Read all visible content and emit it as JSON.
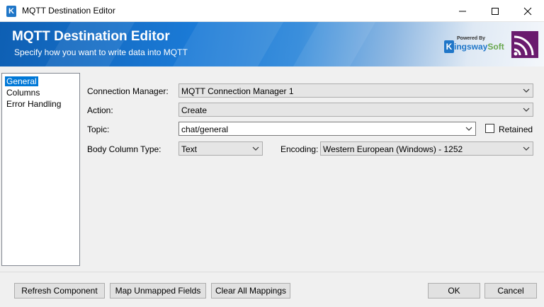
{
  "window": {
    "title": "MQTT Destination Editor",
    "app_icon_letter": "K"
  },
  "banner": {
    "title": "MQTT Destination Editor",
    "subtitle": "Specify how you want to write data into MQTT",
    "logo_powered": "Powered By",
    "logo_letter": "K",
    "logo_name": "ingsway",
    "logo_name_suffix": "Soft"
  },
  "tree": {
    "items": [
      {
        "label": "General",
        "selected": true
      },
      {
        "label": "Columns",
        "selected": false
      },
      {
        "label": "Error Handling",
        "selected": false
      }
    ]
  },
  "form": {
    "connection_manager": {
      "label": "Connection Manager:",
      "value": "MQTT Connection Manager 1"
    },
    "action": {
      "label": "Action:",
      "value": "Create"
    },
    "topic": {
      "label": "Topic:",
      "value": "chat/general"
    },
    "retained": {
      "label": "Retained",
      "checked": false
    },
    "body_column_type": {
      "label": "Body Column Type:",
      "value": "Text"
    },
    "encoding": {
      "label": "Encoding:",
      "value": "Western European (Windows) - 1252"
    }
  },
  "buttons": {
    "refresh": "Refresh Component",
    "map_unmapped": "Map Unmapped Fields",
    "clear_mappings": "Clear All Mappings",
    "ok": "OK",
    "cancel": "Cancel"
  },
  "colors": {
    "accent": "#0078d7",
    "banner_blue": "#1b7ad6",
    "brand_blue": "#1f76c8",
    "brand_green": "#6aa84f",
    "mqtt_purple": "#6a1b6e"
  }
}
